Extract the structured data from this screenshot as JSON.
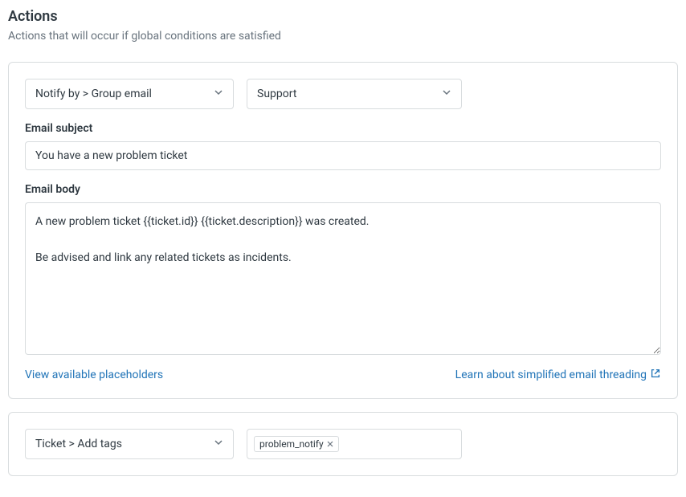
{
  "header": {
    "title": "Actions",
    "subtitle": "Actions that will occur if global conditions are satisfied"
  },
  "actions": [
    {
      "type_select": "Notify by > Group email",
      "target_select": "Support",
      "email_subject_label": "Email subject",
      "email_subject_value": "You have a new problem ticket",
      "email_body_label": "Email body",
      "email_body_value": "A new problem ticket {{ticket.id}} {{ticket.description}} was created.\n\nBe advised and link any related tickets as incidents.",
      "placeholders_link": "View available placeholders",
      "threading_link": "Learn about simplified email threading"
    },
    {
      "type_select": "Ticket > Add tags",
      "tags": [
        "problem_notify"
      ]
    }
  ]
}
